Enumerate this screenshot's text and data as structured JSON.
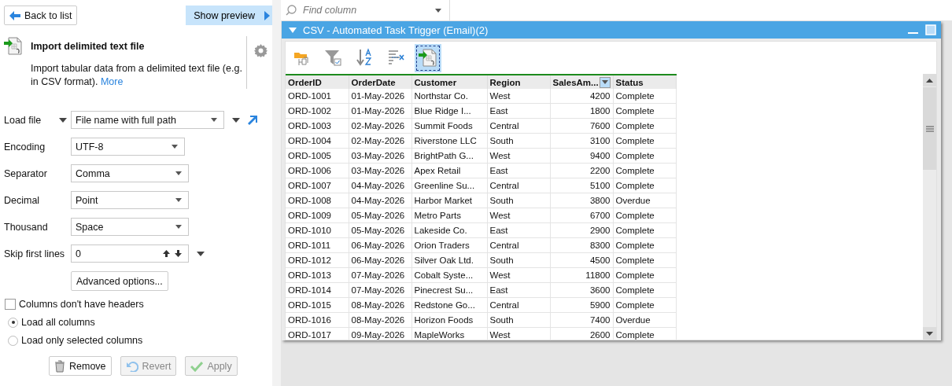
{
  "sidebar": {
    "back_button": "Back to list",
    "preview_button": "Show preview",
    "node": {
      "title": "Import delimited text file",
      "description": "Import tabular data from a delimited text file (e.g. in CSV format).",
      "link": "More"
    },
    "load_file": {
      "label": "Load file",
      "value": "File name with full path"
    },
    "fields": [
      {
        "label": "Encoding",
        "value": "UTF-8",
        "kind": "select"
      },
      {
        "label": "Separator",
        "value": "Comma",
        "kind": "select"
      },
      {
        "label": "Decimal",
        "value": "Point",
        "kind": "select"
      },
      {
        "label": "Thousand",
        "value": "Space",
        "kind": "select"
      },
      {
        "label": "Skip first lines",
        "value": "0",
        "kind": "spinner"
      }
    ],
    "advanced_button": "Advanced options...",
    "headers_checkbox": {
      "label": "Columns don't have headers",
      "checked": false
    },
    "column_options": [
      {
        "label": "Load all columns",
        "selected": true
      },
      {
        "label": "Load only selected columns",
        "selected": false
      }
    ],
    "actions": [
      {
        "label": "Remove",
        "kind": "remove",
        "disabled": false
      },
      {
        "label": "Revert",
        "kind": "revert",
        "disabled": true
      },
      {
        "label": "Apply",
        "kind": "apply",
        "disabled": true
      }
    ]
  },
  "search": {
    "placeholder": "Find column"
  },
  "panel": {
    "title": "CSV - Automated Task Trigger (Email)(2)",
    "expanded": true,
    "toolbar": [
      {
        "kind": "open",
        "selected": false
      },
      {
        "kind": "filter",
        "selected": false
      },
      {
        "kind": "sort",
        "selected": false
      },
      {
        "kind": "split",
        "selected": false
      },
      {
        "kind": "import",
        "selected": true
      }
    ],
    "table": {
      "columns": [
        {
          "label": "OrderID",
          "kind": "text",
          "filter_button": false
        },
        {
          "label": "OrderDate",
          "kind": "text",
          "filter_button": false
        },
        {
          "label": "Customer",
          "kind": "text",
          "filter_button": false
        },
        {
          "label": "Region",
          "kind": "text",
          "filter_button": false
        },
        {
          "label": "SalesAm...",
          "kind": "number",
          "filter_button": true
        },
        {
          "label": "Status",
          "kind": "text",
          "filter_button": false
        }
      ],
      "rows": [
        [
          "ORD-1001",
          "01-May-2026",
          "Northstar Co.",
          "West",
          "4200",
          "Complete"
        ],
        [
          "ORD-1002",
          "01-May-2026",
          "Blue Ridge I...",
          "East",
          "1800",
          "Complete"
        ],
        [
          "ORD-1003",
          "02-May-2026",
          "Summit Foods",
          "Central",
          "7600",
          "Complete"
        ],
        [
          "ORD-1004",
          "02-May-2026",
          "Riverstone LLC",
          "South",
          "3100",
          "Complete"
        ],
        [
          "ORD-1005",
          "03-May-2026",
          "BrightPath G...",
          "West",
          "9400",
          "Complete"
        ],
        [
          "ORD-1006",
          "03-May-2026",
          "Apex Retail",
          "East",
          "2200",
          "Complete"
        ],
        [
          "ORD-1007",
          "04-May-2026",
          "Greenline Su...",
          "Central",
          "5100",
          "Complete"
        ],
        [
          "ORD-1008",
          "04-May-2026",
          "Harbor Market",
          "South",
          "3800",
          "Overdue"
        ],
        [
          "ORD-1009",
          "05-May-2026",
          "Metro Parts",
          "West",
          "6700",
          "Complete"
        ],
        [
          "ORD-1010",
          "05-May-2026",
          "Lakeside Co.",
          "East",
          "2900",
          "Complete"
        ],
        [
          "ORD-1011",
          "06-May-2026",
          "Orion Traders",
          "Central",
          "8300",
          "Complete"
        ],
        [
          "ORD-1012",
          "06-May-2026",
          "Silver Oak Ltd.",
          "South",
          "4500",
          "Complete"
        ],
        [
          "ORD-1013",
          "07-May-2026",
          "Cobalt Syste...",
          "West",
          "11800",
          "Complete"
        ],
        [
          "ORD-1014",
          "07-May-2026",
          "Pinecrest Su...",
          "East",
          "3600",
          "Complete"
        ],
        [
          "ORD-1015",
          "08-May-2026",
          "Redstone Go...",
          "Central",
          "5900",
          "Complete"
        ],
        [
          "ORD-1016",
          "08-May-2026",
          "Horizon Foods",
          "South",
          "7400",
          "Overdue"
        ],
        [
          "ORD-1017",
          "09-May-2026",
          "MapleWorks",
          "West",
          "2600",
          "Complete"
        ]
      ]
    }
  }
}
